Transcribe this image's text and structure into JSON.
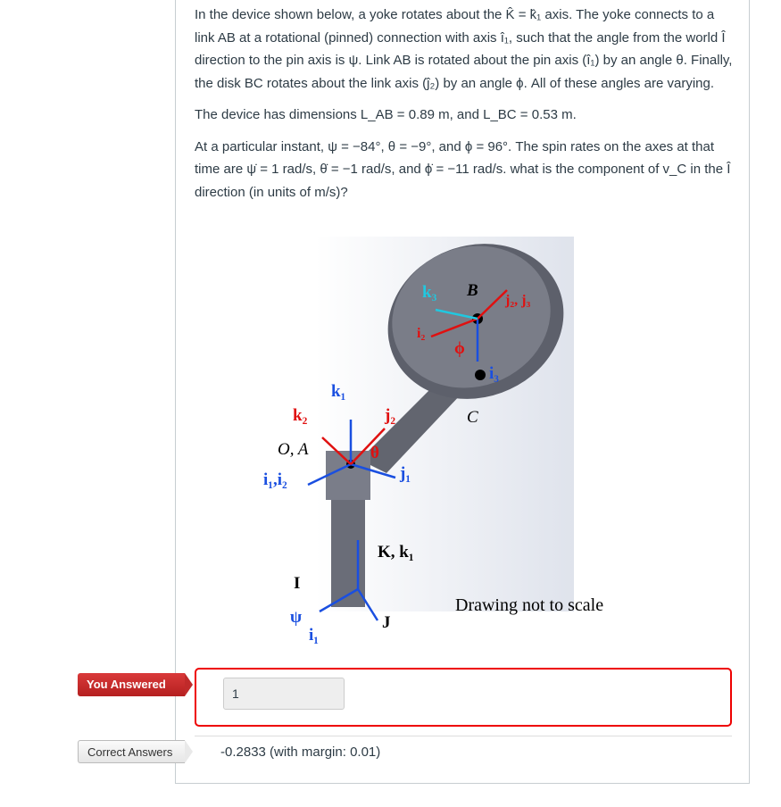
{
  "question": {
    "paragraphs": [
      "In the device shown below, a yoke rotates about the K̂ = k̂₁ axis. The yoke connects to a link AB at a rotational (pinned) connection with axis î₁, such that the angle from the world Î direction to the pin axis is ψ. Link AB is rotated about the pin axis (î₁) by an angle θ. Finally, the disk BC rotates about the link axis (ĵ₂) by an angle ϕ. All of these angles are varying.",
      "The device has dimensions L_AB = 0.89 m, and L_BC = 0.53 m.",
      "At a particular instant, ψ = −84°, θ = −9°, and ϕ = 96°. The spin rates on the axes at that time are ψ̇ = 1 rad/s, θ̇ = −1 rad/s, and ϕ̇ = −11 rad/s. what is the component of v_C in the Î direction (in units of m/s)?"
    ]
  },
  "figure": {
    "labels": {
      "k3": "k₃",
      "B": "B",
      "j2j3": "j₂, j₃",
      "i2": "i₂",
      "phi": "ϕ",
      "i3": "i₃",
      "C": "C",
      "k1": "k₁",
      "k2": "k₂",
      "j2": "j₂",
      "OA": "O, A",
      "theta": "θ",
      "j1": "j₁",
      "i1i2": "i₁,i₂",
      "Kk1": "K, k₁",
      "I": "I",
      "psi": "ψ",
      "i1": "i₁",
      "J": "J"
    },
    "note": "Drawing not to scale"
  },
  "answer": {
    "you_answered_label": "You Answered",
    "value": "1",
    "correct_label": "Correct Answers",
    "correct_text": "-0.2833 (with margin: 0.01)"
  },
  "colors": {
    "wrong": "#e00000",
    "blue": "#1a4fe0",
    "red": "#e01010",
    "cyan": "#20c8e0"
  }
}
